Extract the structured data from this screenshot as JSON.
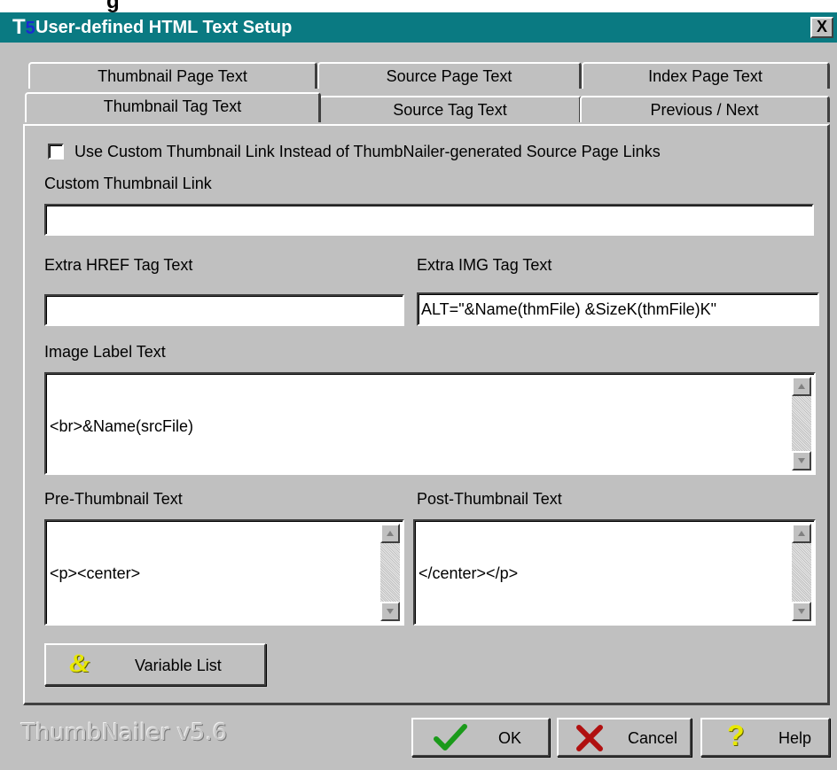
{
  "window": {
    "title": "User-defined HTML Text Setup",
    "icon": "T5",
    "close_label": "X",
    "background_title_fragment": "g"
  },
  "tabs": {
    "row_back": [
      "Thumbnail Page Text",
      "Source Page Text",
      "Index Page Text"
    ],
    "row_front": [
      "Thumbnail Tag Text",
      "Source Tag Text",
      "Previous / Next"
    ],
    "active": "Thumbnail Tag Text"
  },
  "form": {
    "use_custom_link_label": "Use Custom Thumbnail Link Instead of ThumbNailer-generated Source Page Links",
    "use_custom_link_checked": false,
    "custom_link_label": "Custom Thumbnail Link",
    "custom_link_value": "",
    "extra_href_label": "Extra HREF Tag Text",
    "extra_href_value": "",
    "extra_img_label": "Extra IMG Tag Text",
    "extra_img_value": "ALT=\"&Name(thmFile) &SizeK(thmFile)K\"",
    "image_label_label": "Image Label Text",
    "image_label_value": "<br>&Name(srcFile)",
    "pre_thumb_label": "Pre-Thumbnail Text",
    "pre_thumb_value": "<p><center>",
    "post_thumb_label": "Post-Thumbnail Text",
    "post_thumb_value": "</center></p>",
    "variable_list_label": "Variable List",
    "variable_list_icon": "&"
  },
  "footer": {
    "brand": "ThumbNailer v5.6",
    "ok_label": "OK",
    "cancel_label": "Cancel",
    "help_label": "Help",
    "help_icon": "?"
  },
  "colors": {
    "titlebar": "#0a7a82",
    "face": "#c0c0c0",
    "ok_check": "#1a9a1a",
    "cancel_x": "#b01010",
    "help_q": "#e8e800",
    "amp": "#e8e800"
  }
}
